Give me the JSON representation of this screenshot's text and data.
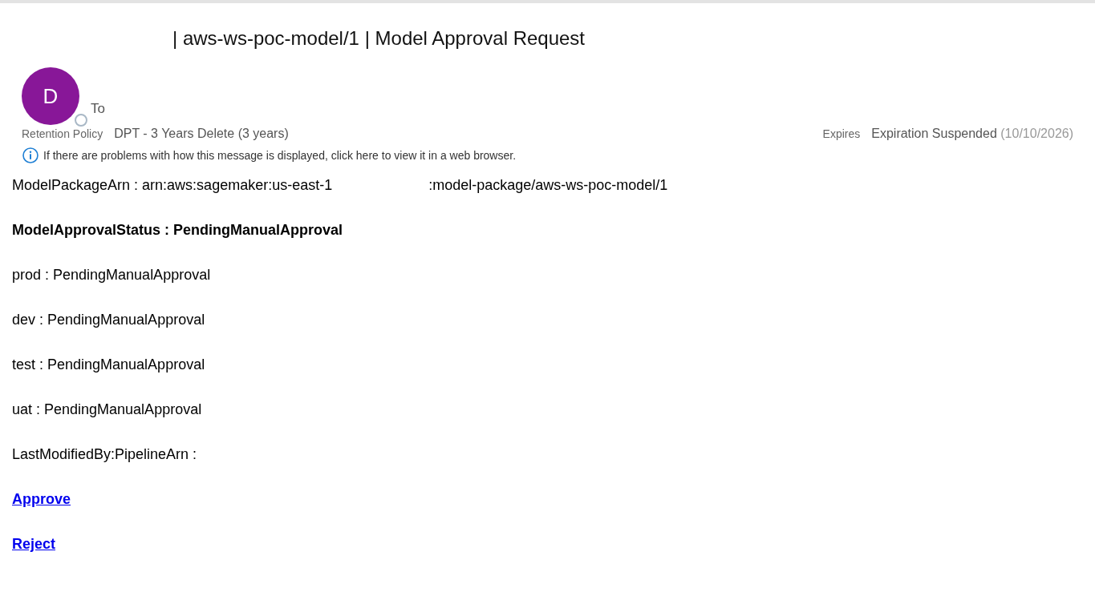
{
  "subject": "| aws-ws-poc-model/1 | Model Approval Request",
  "sender": {
    "initial": "D",
    "to_label": "To"
  },
  "retention": {
    "label": "Retention Policy",
    "value": "DPT - 3 Years Delete (3 years)"
  },
  "expires": {
    "label": "Expires",
    "value": "Expiration Suspended",
    "date": "(10/10/2026)"
  },
  "info_bar": "If there are problems with how this message is displayed, click here to view it in a web browser.",
  "body": [
    {
      "kind": "split",
      "text": "ModelPackageArn : arn:aws:sagemaker:us-east-1",
      "rest": ":model-package/aws-ws-poc-model/1"
    },
    {
      "kind": "bold",
      "text": "ModelApprovalStatus : PendingManualApproval"
    },
    {
      "kind": "plain",
      "text": "prod : PendingManualApproval"
    },
    {
      "kind": "plain",
      "text": "dev : PendingManualApproval"
    },
    {
      "kind": "plain",
      "text": "test : PendingManualApproval"
    },
    {
      "kind": "plain",
      "text": "uat : PendingManualApproval"
    },
    {
      "kind": "plain",
      "text": "LastModifiedBy:PipelineArn :"
    },
    {
      "kind": "link",
      "text": "Approve"
    },
    {
      "kind": "link",
      "text": "Reject"
    }
  ]
}
